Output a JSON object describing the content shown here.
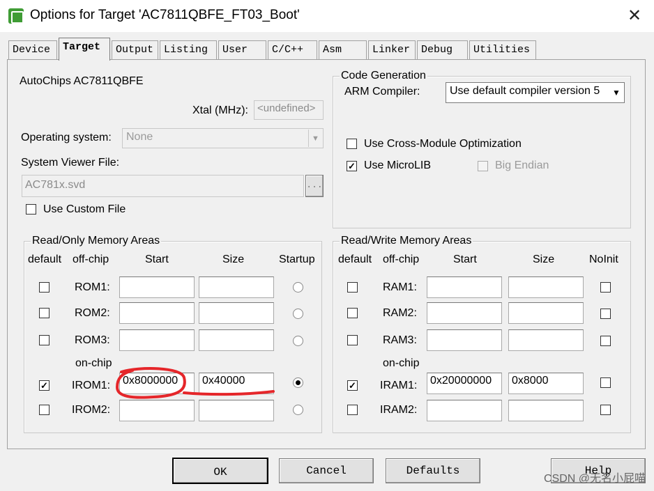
{
  "window": {
    "title": "Options for Target 'AC7811QBFE_FT03_Boot'",
    "close_glyph": "✕"
  },
  "tabs": [
    "Device",
    "Target",
    "Output",
    "Listing",
    "User",
    "C/C++",
    "Asm",
    "Linker",
    "Debug",
    "Utilities"
  ],
  "active_tab": "Target",
  "device": {
    "name": "AutoChips AC7811QBFE",
    "xtal_label": "Xtal (MHz):",
    "xtal_value": "<undefined>",
    "os_label": "Operating system:",
    "os_value": "None",
    "svd_label": "System Viewer File:",
    "svd_value": "AC781x.svd",
    "browse_label": "...",
    "custom_file_label": "Use Custom File",
    "custom_file_checked": false
  },
  "code_generation": {
    "title": "Code Generation",
    "compiler_label": "ARM Compiler:",
    "compiler_value": "Use default compiler version 5",
    "cross_module_label": "Use Cross-Module Optimization",
    "cross_module_checked": false,
    "microlib_label": "Use MicroLIB",
    "microlib_checked": true,
    "big_endian_label": "Big Endian",
    "big_endian_checked": false
  },
  "ro_memory": {
    "title": "Read/Only Memory Areas",
    "headers": {
      "default": "default",
      "offchip": "off-chip",
      "start": "Start",
      "size": "Size",
      "startup": "Startup"
    },
    "onchip_label": "on-chip",
    "rows": [
      {
        "label": "ROM1:",
        "default": false,
        "start": "",
        "size": "",
        "startup": false
      },
      {
        "label": "ROM2:",
        "default": false,
        "start": "",
        "size": "",
        "startup": false
      },
      {
        "label": "ROM3:",
        "default": false,
        "start": "",
        "size": "",
        "startup": false
      },
      {
        "label": "IROM1:",
        "default": true,
        "start": "0x8000000",
        "size": "0x40000",
        "startup": true
      },
      {
        "label": "IROM2:",
        "default": false,
        "start": "",
        "size": "",
        "startup": false
      }
    ]
  },
  "rw_memory": {
    "title": "Read/Write Memory Areas",
    "headers": {
      "default": "default",
      "offchip": "off-chip",
      "start": "Start",
      "size": "Size",
      "noinit": "NoInit"
    },
    "onchip_label": "on-chip",
    "rows": [
      {
        "label": "RAM1:",
        "default": false,
        "start": "",
        "size": "",
        "noinit": false
      },
      {
        "label": "RAM2:",
        "default": false,
        "start": "",
        "size": "",
        "noinit": false
      },
      {
        "label": "RAM3:",
        "default": false,
        "start": "",
        "size": "",
        "noinit": false
      },
      {
        "label": "IRAM1:",
        "default": true,
        "start": "0x20000000",
        "size": "0x8000",
        "noinit": false
      },
      {
        "label": "IRAM2:",
        "default": false,
        "start": "",
        "size": "",
        "noinit": false
      }
    ]
  },
  "buttons": {
    "ok": "OK",
    "cancel": "Cancel",
    "defaults": "Defaults",
    "help": "Help"
  },
  "watermark": "CSDN @无名小屁喵",
  "colors": {
    "annotation": "#e5262a",
    "app_icon": "#3f9c35"
  }
}
